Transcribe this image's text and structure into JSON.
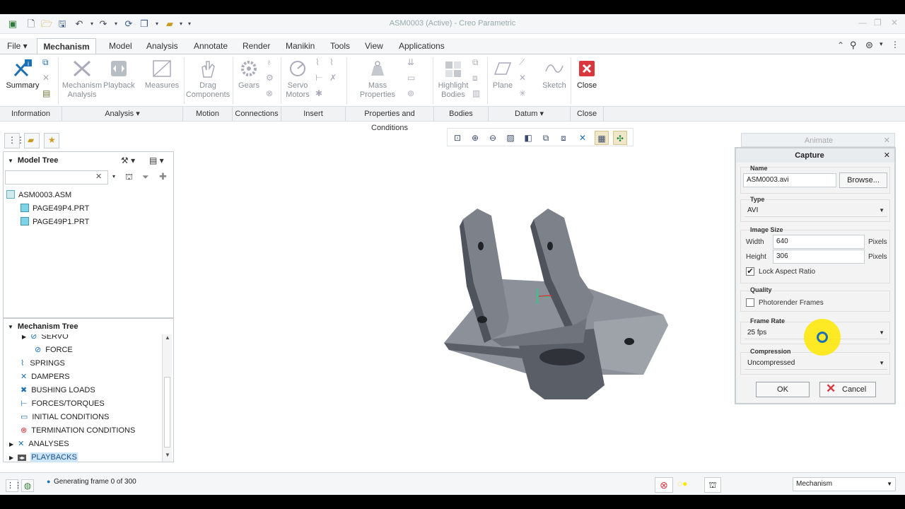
{
  "window": {
    "title": "ASM0003 (Active) - Creo Parametric"
  },
  "tabs": [
    {
      "label": "File",
      "name": "tab-file"
    },
    {
      "label": "Mechanism",
      "name": "tab-mechanism"
    },
    {
      "label": "Model",
      "name": "tab-model"
    },
    {
      "label": "Analysis",
      "name": "tab-analysis"
    },
    {
      "label": "Annotate",
      "name": "tab-annotate"
    },
    {
      "label": "Render",
      "name": "tab-render"
    },
    {
      "label": "Manikin",
      "name": "tab-manikin"
    },
    {
      "label": "Tools",
      "name": "tab-tools"
    },
    {
      "label": "View",
      "name": "tab-view"
    },
    {
      "label": "Applications",
      "name": "tab-applications"
    }
  ],
  "ribbon": {
    "summary": "Summary",
    "mech_analysis_1": "Mechanism",
    "mech_analysis_2": "Analysis",
    "playback": "Playback",
    "measures": "Measures",
    "drag_1": "Drag",
    "drag_2": "Components",
    "gears": "Gears",
    "servo_1": "Servo",
    "servo_2": "Motors",
    "mass_1": "Mass",
    "mass_2": "Properties",
    "highlight_1": "Highlight",
    "highlight_2": "Bodies",
    "plane": "Plane",
    "sketch": "Sketch",
    "close": "Close"
  },
  "groups": [
    {
      "label": "Information"
    },
    {
      "label": "Analysis ▾"
    },
    {
      "label": "Motion"
    },
    {
      "label": "Connections"
    },
    {
      "label": "Insert"
    },
    {
      "label": "Properties and Conditions"
    },
    {
      "label": "Bodies"
    },
    {
      "label": "Datum ▾"
    },
    {
      "label": "Close"
    }
  ],
  "model_tree": {
    "header": "Model Tree",
    "search_placeholder": "",
    "items": [
      {
        "label": "ASM0003.ASM"
      },
      {
        "label": "PAGE49P4.PRT"
      },
      {
        "label": "PAGE49P1.PRT"
      }
    ]
  },
  "mech_tree": {
    "header": "Mechanism Tree",
    "items": [
      {
        "label": "SERVO"
      },
      {
        "label": "FORCE"
      },
      {
        "label": "SPRINGS"
      },
      {
        "label": "DAMPERS"
      },
      {
        "label": "BUSHING LOADS"
      },
      {
        "label": "FORCES/TORQUES"
      },
      {
        "label": "INITIAL CONDITIONS"
      },
      {
        "label": "TERMINATION CONDITIONS"
      },
      {
        "label": "ANALYSES"
      },
      {
        "label": "PLAYBACKS"
      }
    ]
  },
  "animate_title": "Animate",
  "capture": {
    "title": "Capture",
    "name_label": "Name",
    "name_value": "ASM0003.avi",
    "browse": "Browse...",
    "type_label": "Type",
    "type_value": "AVI",
    "image_size_label": "Image Size",
    "width_label": "Width",
    "width_value": "640",
    "height_label": "Height",
    "height_value": "306",
    "pixels": "Pixels",
    "lock_label": "Lock Aspect Ratio",
    "lock_checked": true,
    "quality_label": "Quality",
    "photorender_label": "Photorender Frames",
    "photorender_checked": false,
    "framerate_label": "Frame Rate",
    "framerate_value": "25 fps",
    "compression_label": "Compression",
    "compression_value": "Uncompressed",
    "ok": "OK",
    "cancel": "Cancel"
  },
  "status": {
    "message": "Generating frame 0 of 300",
    "mode_value": "Mechanism"
  },
  "colors": {
    "accent": "#1a6fb5",
    "close_red": "#d9363e",
    "cursor_yellow": "#ffe600",
    "part_gray": "#8c9098"
  }
}
